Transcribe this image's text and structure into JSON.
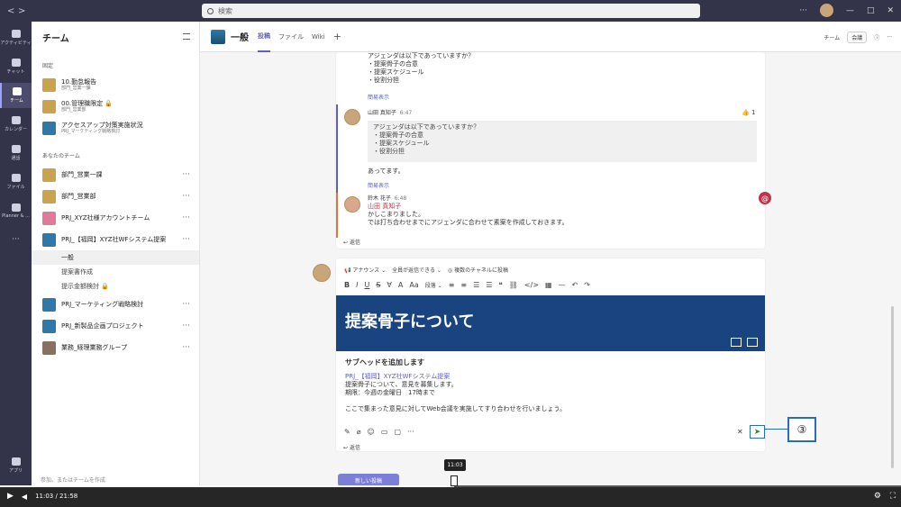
{
  "titlebar": {
    "search_placeholder": "検索",
    "back": "<",
    "forward": ">",
    "minimize": "—",
    "maximize": "□",
    "close": "✕",
    "more": "···"
  },
  "rail": [
    {
      "label": "アクティビティ"
    },
    {
      "label": "チャット"
    },
    {
      "label": "チーム"
    },
    {
      "label": "カレンダー"
    },
    {
      "label": "通話"
    },
    {
      "label": "ファイル"
    },
    {
      "label": "Planner & ..."
    },
    {
      "label": "···"
    },
    {
      "label": "アプリ"
    }
  ],
  "teams_pane": {
    "title": "チーム",
    "pinned_label": "固定",
    "pinned": [
      {
        "name": "10.勤怠報告",
        "sub": "部門_営業一課"
      },
      {
        "name": "00.管理職限定",
        "sub": "部門_営業部"
      },
      {
        "name": "アクセスアップ対策実施状況",
        "sub": "PRJ_マーケティング戦略検討"
      }
    ],
    "your_teams_label": "あなたのチーム",
    "teams": [
      {
        "name": "部門_営業一課"
      },
      {
        "name": "部門_営業部"
      },
      {
        "name": "PRJ_XYZ社様アカウントチーム"
      },
      {
        "name": "PRJ_【福岡】XYZ社WFシステム提案"
      }
    ],
    "channels": [
      {
        "name": "一般"
      },
      {
        "name": "提案書作成"
      },
      {
        "name": "提示金額検討"
      }
    ],
    "teams2": [
      {
        "name": "PRJ_マーケティング戦略検討"
      },
      {
        "name": "PRJ_新製品企画プロジェクト"
      },
      {
        "name": "業務_経理業務グループ"
      }
    ],
    "footer": "参加、またはチームを作成"
  },
  "channel": {
    "name": "一般",
    "tabs": [
      "投稿",
      "ファイル",
      "Wiki",
      "+"
    ],
    "team_btn": "チーム",
    "meet_btn": "会議"
  },
  "thread": {
    "msg1_lines": [
      "アジェンダは以下であっていますか？",
      "・提案骨子の合意",
      "・提案スケジュール",
      "・役割分担"
    ],
    "collapse": "簡易表示",
    "reply1": {
      "author": "山田 真知子",
      "time": "6:47",
      "quote": [
        "アジェンダは以下であっていますか？",
        "・提案骨子の合意",
        "・提案スケジュール",
        "・役割分担"
      ],
      "text": "あってます。",
      "reaction": "👍 1"
    },
    "collapse2": "簡易表示",
    "reply2": {
      "author": "鈴木 花子",
      "time": "6:48",
      "mention": "山田 真知子",
      "line1": "かしこまりました。",
      "line2": "では打ち合わせまでにアジェンダに合わせて素案を作成しておきます。"
    },
    "reply_label": "返信"
  },
  "editor": {
    "announce": "アナウンス",
    "everyone": "全員が返信できる",
    "multi": "複数のチャネルに投稿",
    "format_para": "段落",
    "headline": "提案骨子について",
    "subhead": "サブヘッドを追加します",
    "body_lines": [
      "PRJ_【福岡】XYZ社WFシステム提案",
      "提案骨子について、意見を募集します。",
      "期限：今週の金曜日　17時まで",
      "",
      "ここで集まった意見に対してWeb会議を実施してすり合わせを行いましょう。"
    ],
    "reply_label": "返信",
    "callout": "③"
  },
  "newpost": "新しい投稿",
  "player": {
    "time": "11:03 / 21:58",
    "tooltip": "11:03",
    "progress": 0.504
  }
}
